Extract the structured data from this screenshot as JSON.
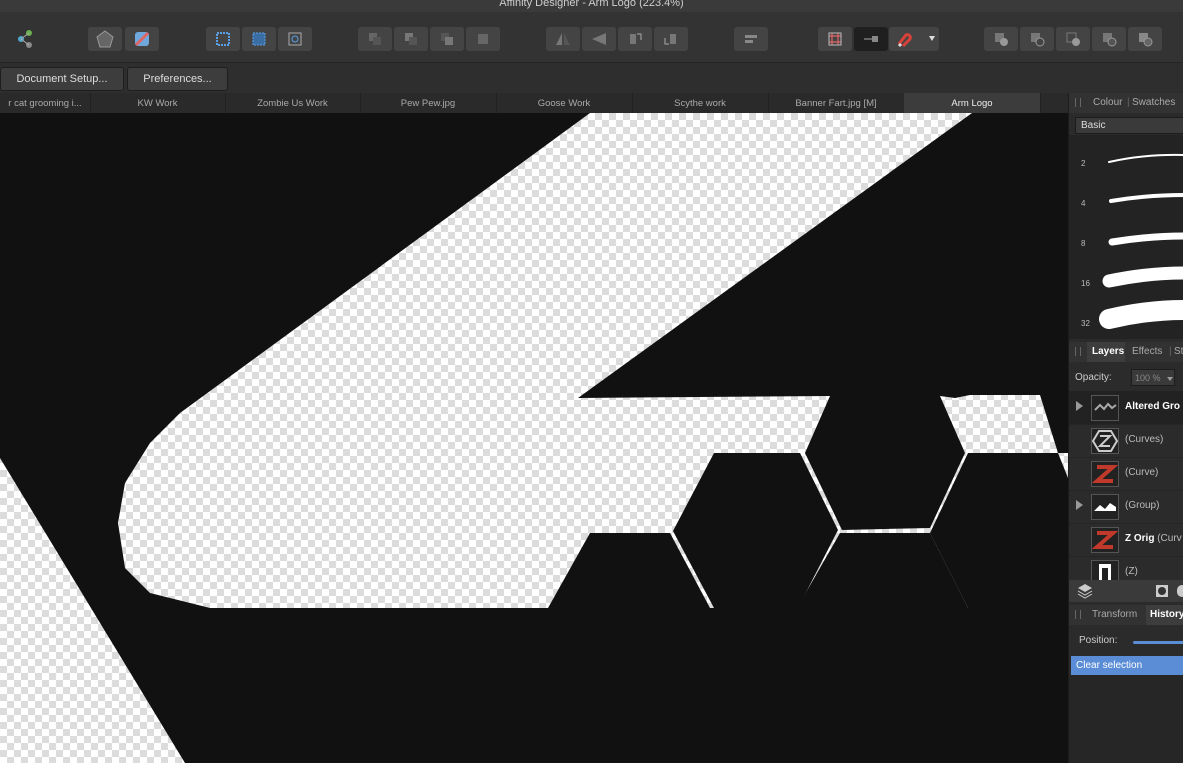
{
  "window": {
    "title": "Affinity Designer - Arm Logo (223.4%)"
  },
  "toolbar": {
    "icons": [
      "persona-icon",
      "publisher-icon",
      "designer-persona-icon",
      "snapping-grid-icon",
      "selection-box-icon",
      "transform-icon",
      "arrange-back-icon",
      "arrange-backward-icon",
      "arrange-forward-icon",
      "arrange-front-icon",
      "flip-horizontal-icon",
      "flip-vertical-icon",
      "rotate-left-icon",
      "rotate-right-icon",
      "align-icon",
      "grid-icon",
      "pixel-snap-icon",
      "magnet-icon",
      "dropdown-chevron-icon",
      "boolean-add-icon",
      "boolean-subtract-icon",
      "boolean-intersect-icon",
      "boolean-xor-icon",
      "boolean-divide-icon"
    ]
  },
  "context": {
    "document_setup": "Document Setup...",
    "preferences": "Preferences..."
  },
  "tabs": [
    "r cat grooming i...",
    "KW Work",
    "Zombie Us Work",
    "Pew Pew.jpg",
    "Goose Work",
    "Scythe work",
    "Banner Fart.jpg [M]",
    "Arm Logo"
  ],
  "active_tab": "Arm Logo",
  "brushes": {
    "tabs": [
      "Colour",
      "Swatches"
    ],
    "category": "Basic",
    "sizes": [
      "2",
      "4",
      "8",
      "16",
      "32"
    ]
  },
  "layers": {
    "tabs": [
      "Layers",
      "Effects",
      "St"
    ],
    "opacity_label": "Opacity:",
    "opacity_value": "100 %",
    "items": [
      {
        "name": "Altered Gro",
        "sub": ""
      },
      {
        "name": "",
        "sub": "(Curves)"
      },
      {
        "name": "",
        "sub": "(Curve)"
      },
      {
        "name": "",
        "sub": "(Group)"
      },
      {
        "name": "Z Orig",
        "sub": " (Curv"
      },
      {
        "name": "",
        "sub": "(Z)"
      }
    ]
  },
  "history": {
    "tabs": [
      "Transform",
      "History"
    ],
    "position_label": "Position:",
    "entries": [
      "Clear selection"
    ]
  },
  "colors": {
    "accent": "#5a8dd6",
    "artwork": "#111111"
  }
}
